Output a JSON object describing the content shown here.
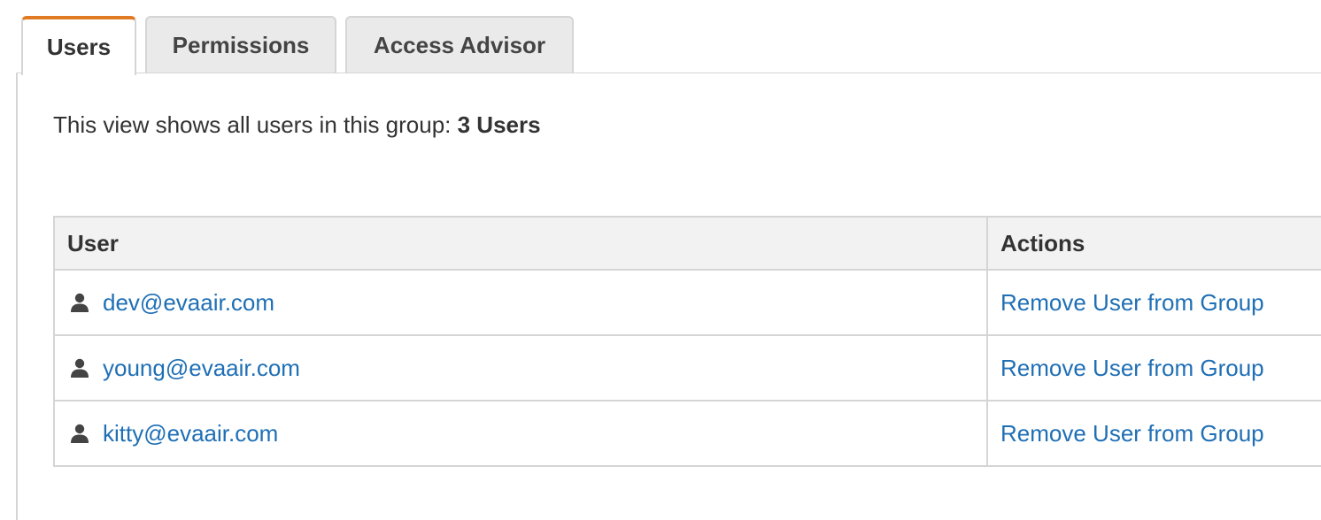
{
  "tabs": [
    {
      "label": "Users",
      "active": true
    },
    {
      "label": "Permissions",
      "active": false
    },
    {
      "label": "Access Advisor",
      "active": false
    }
  ],
  "summary": {
    "prefix": "This view shows all users in this group: ",
    "count": "3 Users"
  },
  "table": {
    "columns": [
      "User",
      "Actions"
    ],
    "rows": [
      {
        "user": "dev@evaair.com",
        "action": "Remove User from Group",
        "icon": "user-icon"
      },
      {
        "user": "young@evaair.com",
        "action": "Remove User from Group",
        "icon": "user-icon"
      },
      {
        "user": "kitty@evaair.com",
        "action": "Remove User from Group",
        "icon": "user-icon"
      }
    ]
  },
  "colors": {
    "accent": "#e07b23",
    "link": "#1f6fb5",
    "border": "#d5d5d5",
    "header_bg": "#f2f2f2"
  }
}
